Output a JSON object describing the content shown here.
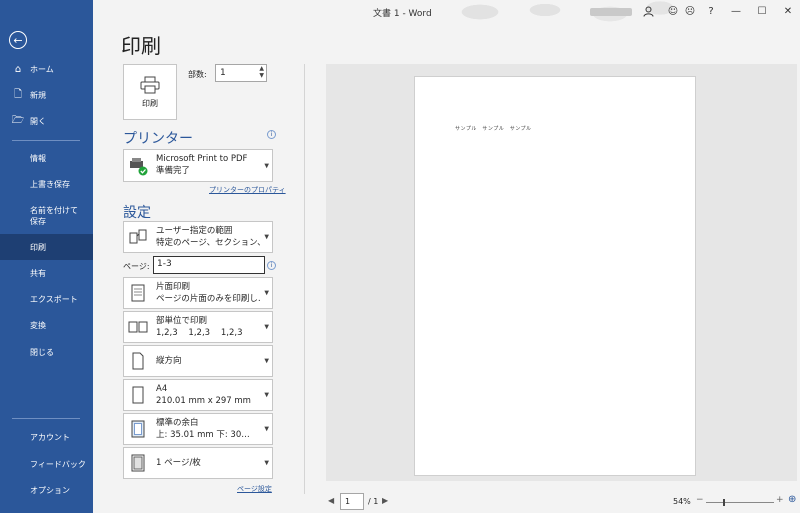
{
  "window": {
    "title": "文書 1  -  Word",
    "buttons": {
      "minimize": "—",
      "maximize": "☐",
      "close": "✕",
      "help": "?"
    }
  },
  "sidebar": {
    "back_icon": "arrow-left-icon",
    "items": [
      {
        "label": "ホーム",
        "icon": "home-icon"
      },
      {
        "label": "新規",
        "icon": "new-document-icon"
      },
      {
        "label": "開く",
        "icon": "open-folder-icon"
      },
      {
        "label": "情報"
      },
      {
        "label": "上書き保存"
      },
      {
        "label": "名前を付けて保存"
      },
      {
        "label": "印刷",
        "active": true
      },
      {
        "label": "共有"
      },
      {
        "label": "エクスポート"
      },
      {
        "label": "変換"
      },
      {
        "label": "閉じる"
      }
    ],
    "bottom_items": [
      {
        "label": "アカウント"
      },
      {
        "label": "フィードバック"
      },
      {
        "label": "オプション"
      }
    ]
  },
  "print": {
    "heading": "印刷",
    "print_button_label": "印刷",
    "copies_label": "部数:",
    "copies_value": "1"
  },
  "printer": {
    "heading": "プリンター",
    "name": "Microsoft Print to PDF",
    "status": "準備完了",
    "properties_link": "プリンターのプロパティ"
  },
  "settings": {
    "heading": "設定",
    "range": {
      "line1": "ユーザー指定の範囲",
      "line2": "特定のページ、セクション、…"
    },
    "pages_label": "ページ:",
    "pages_value": "1-3",
    "sides": {
      "line1": "片面印刷",
      "line2": "ページの片面のみを印刷し…"
    },
    "collate": {
      "line1": "部単位で印刷",
      "line2": "1,2,3    1,2,3    1,2,3"
    },
    "orientation": {
      "line1": "縦方向"
    },
    "paper": {
      "line1": "A4",
      "line2": "210.01 mm x 297 mm"
    },
    "margins": {
      "line1": "標準の余白",
      "line2": "上: 35.01 mm 下: 30…"
    },
    "per_sheet": {
      "line1": "1 ページ/枚"
    },
    "page_setup_link": "ページ設定"
  },
  "preview": {
    "sample_text": "サンプル　サンプル　サンプル",
    "current_page": "1",
    "total_pages": "/ 1",
    "zoom": "54%",
    "zoom_level": 0.54
  },
  "colors": {
    "sidebar_bg": "#2b579a",
    "sidebar_active": "#1e3f73",
    "accent": "#2b579a",
    "status_ok": "#21a33a"
  }
}
